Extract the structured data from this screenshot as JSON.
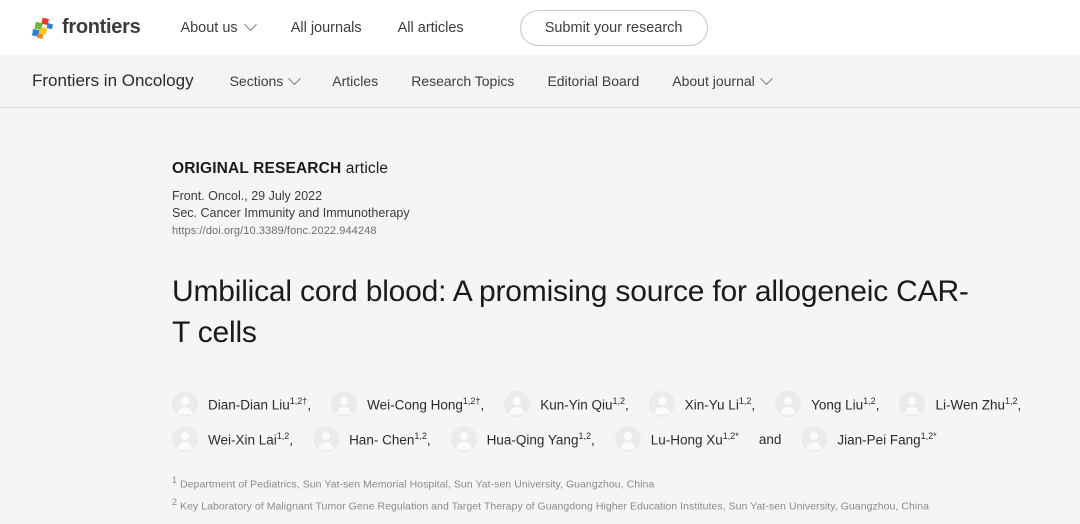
{
  "topnav": {
    "brand": "frontiers",
    "brand_icon": "frontiers-logo-icon",
    "links": [
      {
        "label": "About us",
        "has_chevron": true
      },
      {
        "label": "All journals",
        "has_chevron": false
      },
      {
        "label": "All articles",
        "has_chevron": false
      }
    ],
    "submit_button": "Submit your research"
  },
  "journalnav": {
    "journal": "Frontiers in Oncology",
    "links": [
      {
        "label": "Sections",
        "has_chevron": true
      },
      {
        "label": "Articles",
        "has_chevron": false
      },
      {
        "label": "Research Topics",
        "has_chevron": false
      },
      {
        "label": "Editorial Board",
        "has_chevron": false
      },
      {
        "label": "About journal",
        "has_chevron": true
      }
    ]
  },
  "article": {
    "type_prefix": "ORIGINAL RESEARCH",
    "type_suffix": " article",
    "journal_date": "Front. Oncol., 29 July 2022",
    "section": "Sec. Cancer Immunity and Immunotherapy",
    "doi": "https://doi.org/10.3389/fonc.2022.944248",
    "title": "Umbilical cord blood: A promising source for allogeneic CAR-T cells",
    "author_rows": [
      [
        {
          "name": "Dian-Dian Liu",
          "sup": "1,2†",
          "sep": ","
        },
        {
          "name": "Wei-Cong Hong",
          "sup": "1,2†",
          "sep": ","
        },
        {
          "name": "Kun-Yin Qiu",
          "sup": "1,2",
          "sep": ","
        },
        {
          "name": "Xin-Yu Li",
          "sup": "1,2",
          "sep": ","
        },
        {
          "name": "Yong Liu",
          "sup": "1,2",
          "sep": ","
        },
        {
          "name": "Li-Wen Zhu",
          "sup": "1,2",
          "sep": ","
        }
      ],
      [
        {
          "name": "Wei-Xin Lai",
          "sup": "1,2",
          "sep": ","
        },
        {
          "name": "Han- Chen",
          "sup": "1,2",
          "sep": ","
        },
        {
          "name": "Hua-Qing Yang",
          "sup": "1,2",
          "sep": ","
        },
        {
          "name": "Lu-Hong Xu",
          "sup": "1,2*",
          "sep": "",
          "conj": "and"
        },
        {
          "name": "Jian-Pei Fang",
          "sup": "1,2*",
          "sep": ""
        }
      ]
    ],
    "affiliations": [
      {
        "marker": "1",
        "text": "Department of Pediatrics, Sun Yat-sen Memorial Hospital, Sun Yat-sen University, Guangzhou, China"
      },
      {
        "marker": "2",
        "text": "Key Laboratory of Malignant Tumor Gene Regulation and Target Therapy of Guangdong Higher Education Institutes, Sun Yat-sen University, Guangzhou, China"
      }
    ]
  },
  "colors": {
    "page_bg": "#f5f5f5",
    "nav_bg": "#ffffff",
    "journalnav_bg": "#f4f4f4",
    "text": "#1a1a1a",
    "muted": "#8a8a8a",
    "logo_red": "#e8392e",
    "logo_green": "#6cba3b",
    "logo_blue": "#2e7fd4",
    "logo_yellow": "#f5c518",
    "logo_orange": "#f08c1e"
  }
}
